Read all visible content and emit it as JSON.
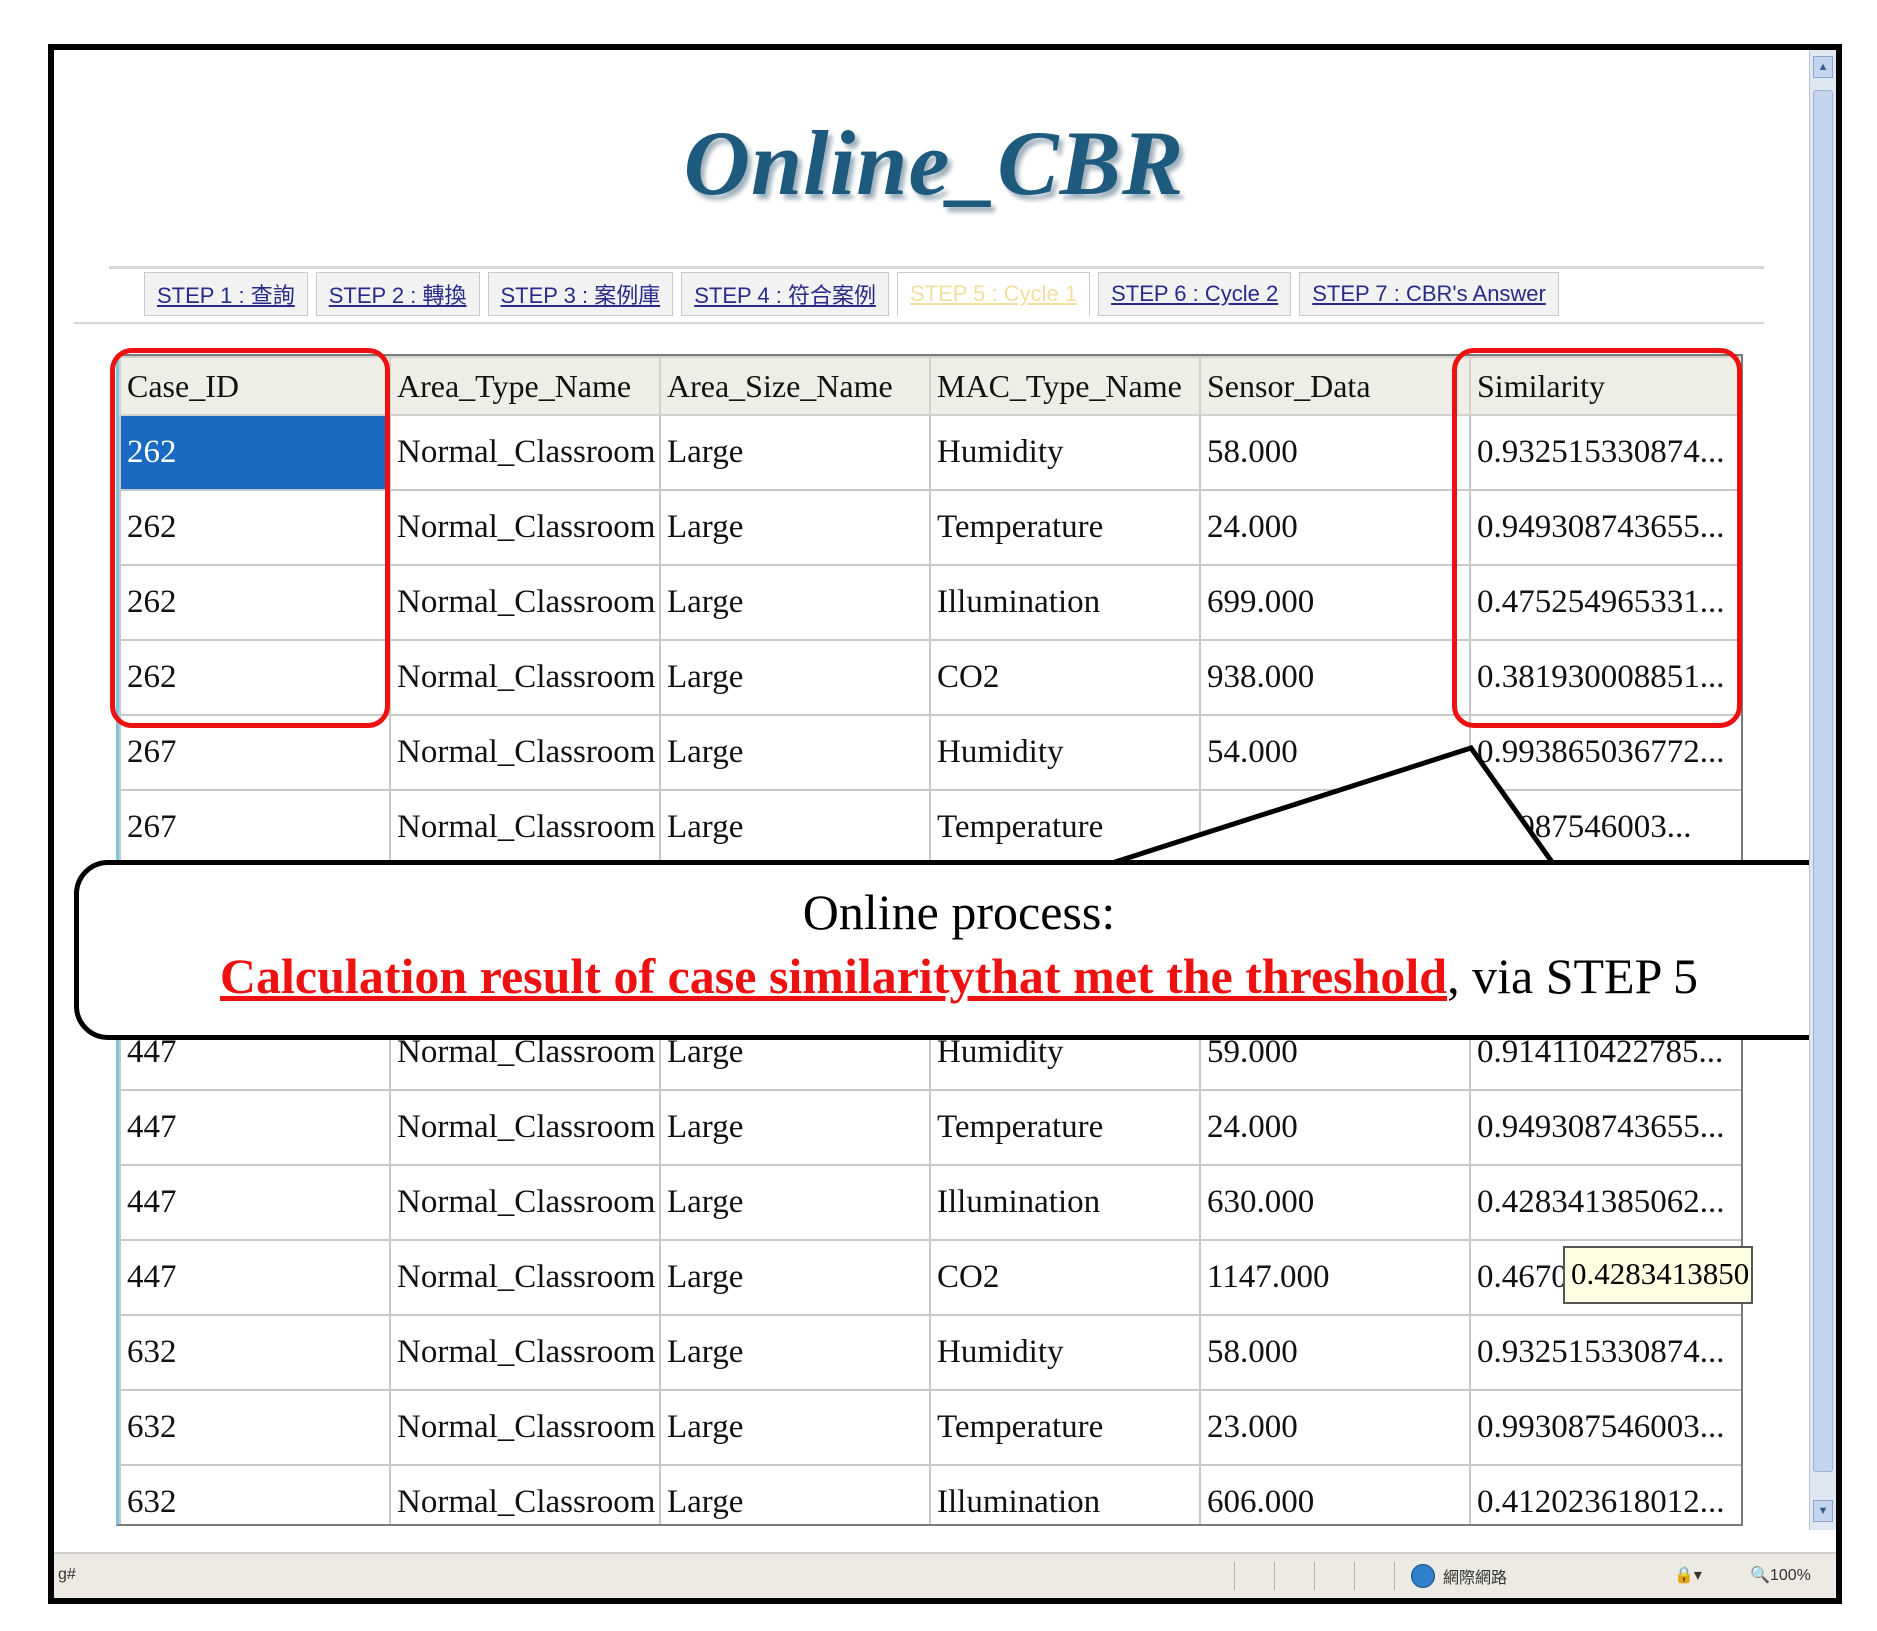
{
  "page": {
    "title": "Online_CBR"
  },
  "tabs": [
    {
      "label": "STEP 1 : 查詢",
      "active": false
    },
    {
      "label": "STEP 2 : 轉換",
      "active": false
    },
    {
      "label": "STEP 3 : 案例庫",
      "active": false
    },
    {
      "label": "STEP 4 : 符合案例",
      "active": false
    },
    {
      "label": "STEP 5 : Cycle 1",
      "active": true
    },
    {
      "label": "STEP 6 : Cycle 2",
      "active": false
    },
    {
      "label": "STEP 7 : CBR's Answer",
      "active": false
    }
  ],
  "table": {
    "columns": [
      "Case_ID",
      "Area_Type_Name",
      "Area_Size_Name",
      "MAC_Type_Name",
      "Sensor_Data",
      "Similarity"
    ],
    "rows": [
      [
        "262",
        "Normal_Classroom",
        "Large",
        "Humidity",
        "58.000",
        "0.932515330874..."
      ],
      [
        "262",
        "Normal_Classroom",
        "Large",
        "Temperature",
        "24.000",
        "0.949308743655..."
      ],
      [
        "262",
        "Normal_Classroom",
        "Large",
        "Illumination",
        "699.000",
        "0.475254965331..."
      ],
      [
        "262",
        "Normal_Classroom",
        "Large",
        "CO2",
        "938.000",
        "0.381930008851..."
      ],
      [
        "267",
        "Normal_Classroom",
        "Large",
        "Humidity",
        "54.000",
        "0.993865036772..."
      ],
      [
        "267",
        "Normal_Classroom",
        "Large",
        "Temperature",
        "",
        "...3087546003..."
      ],
      [
        "",
        "",
        "",
        "",
        "",
        ""
      ],
      [
        "",
        "",
        "",
        "",
        "",
        ""
      ],
      [
        "447",
        "Normal_Classroom",
        "Large",
        "Humidity",
        "59.000",
        "0.914110422785..."
      ],
      [
        "447",
        "Normal_Classroom",
        "Large",
        "Temperature",
        "24.000",
        "0.949308743655..."
      ],
      [
        "447",
        "Normal_Classroom",
        "Large",
        "Illumination",
        "630.000",
        "0.428341385062..."
      ],
      [
        "447",
        "Normal_Classroom",
        "Large",
        "CO2",
        "1147.000",
        "0.4670"
      ],
      [
        "632",
        "Normal_Classroom",
        "Large",
        "Humidity",
        "58.000",
        "0.932515330874..."
      ],
      [
        "632",
        "Normal_Classroom",
        "Large",
        "Temperature",
        "23.000",
        "0.993087546003..."
      ],
      [
        "632",
        "Normal_Classroom",
        "Large",
        "Illumination",
        "606.000",
        "0.412023618012..."
      ]
    ]
  },
  "tooltip": {
    "text": "0.4283413850"
  },
  "callout": {
    "line1": "Online process:",
    "highlight": "Calculation result of case similaritythat met the threshold",
    "suffix": ", via STEP 5"
  },
  "statusbar": {
    "left": "g#",
    "zone": "網際網路",
    "zoom": "100%"
  },
  "colors": {
    "title": "#1d5a7e",
    "highlight": "#ee1111",
    "selection": "#1a6ac4",
    "tab_active": "#f1dfa0"
  },
  "icons": {
    "zone": "globe-icon",
    "security": "lock-icon",
    "zoom": "magnifier-icon"
  }
}
